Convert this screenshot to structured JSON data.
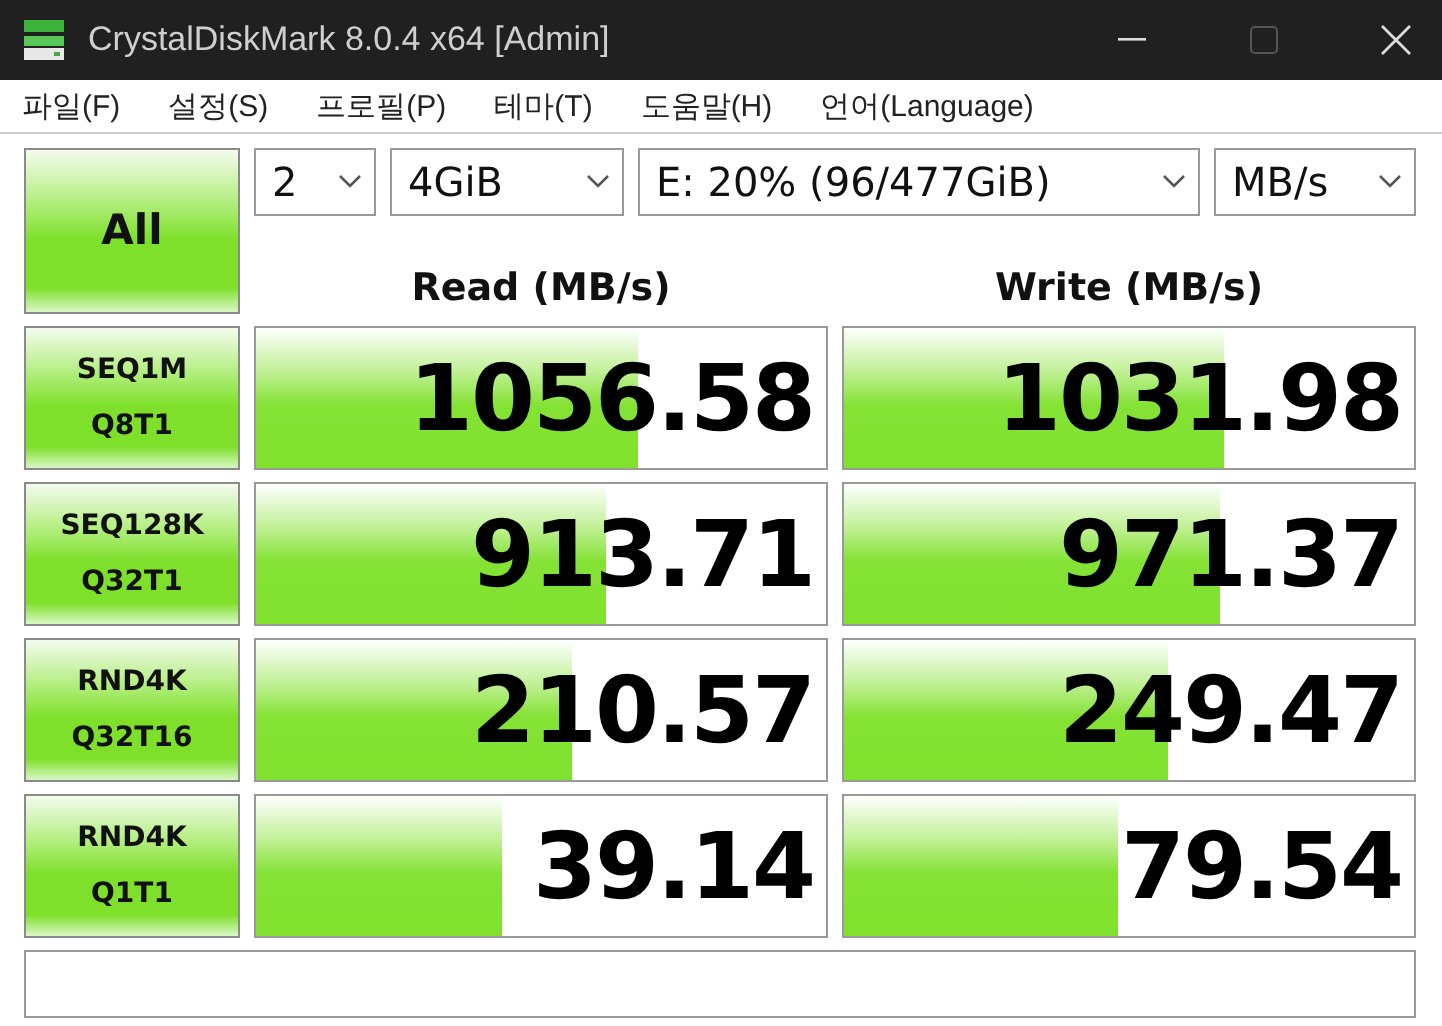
{
  "window": {
    "title": "CrystalDiskMark 8.0.4 x64 [Admin]"
  },
  "menu": [
    "파일(F)",
    "설정(S)",
    "프로필(P)",
    "테마(T)",
    "도움말(H)",
    "언어(Language)"
  ],
  "all_button": "All",
  "selectors": [
    {
      "value": "2"
    },
    {
      "value": "4GiB"
    },
    {
      "value": "E: 20% (96/477GiB)"
    },
    {
      "value": "MB/s"
    }
  ],
  "headers": [
    "Read (MB/s)",
    "Write (MB/s)"
  ],
  "tests": [
    {
      "name": "SEQ1M",
      "params": "Q8T1",
      "read": {
        "value": "1056.58",
        "level": 0.67
      },
      "write": {
        "value": "1031.98",
        "level": 0.665
      }
    },
    {
      "name": "SEQ128K",
      "params": "Q32T1",
      "read": {
        "value": "913.71",
        "level": 0.615
      },
      "write": {
        "value": "971.37",
        "level": 0.66
      }
    },
    {
      "name": "RND4K",
      "params": "Q32T16",
      "read": {
        "value": "210.57",
        "level": 0.555
      },
      "write": {
        "value": "249.47",
        "level": 0.57
      }
    },
    {
      "name": "RND4K",
      "params": "Q1T1",
      "read": {
        "value": "39.14",
        "level": 0.43
      },
      "write": {
        "value": "79.54",
        "level": 0.48
      }
    }
  ]
}
